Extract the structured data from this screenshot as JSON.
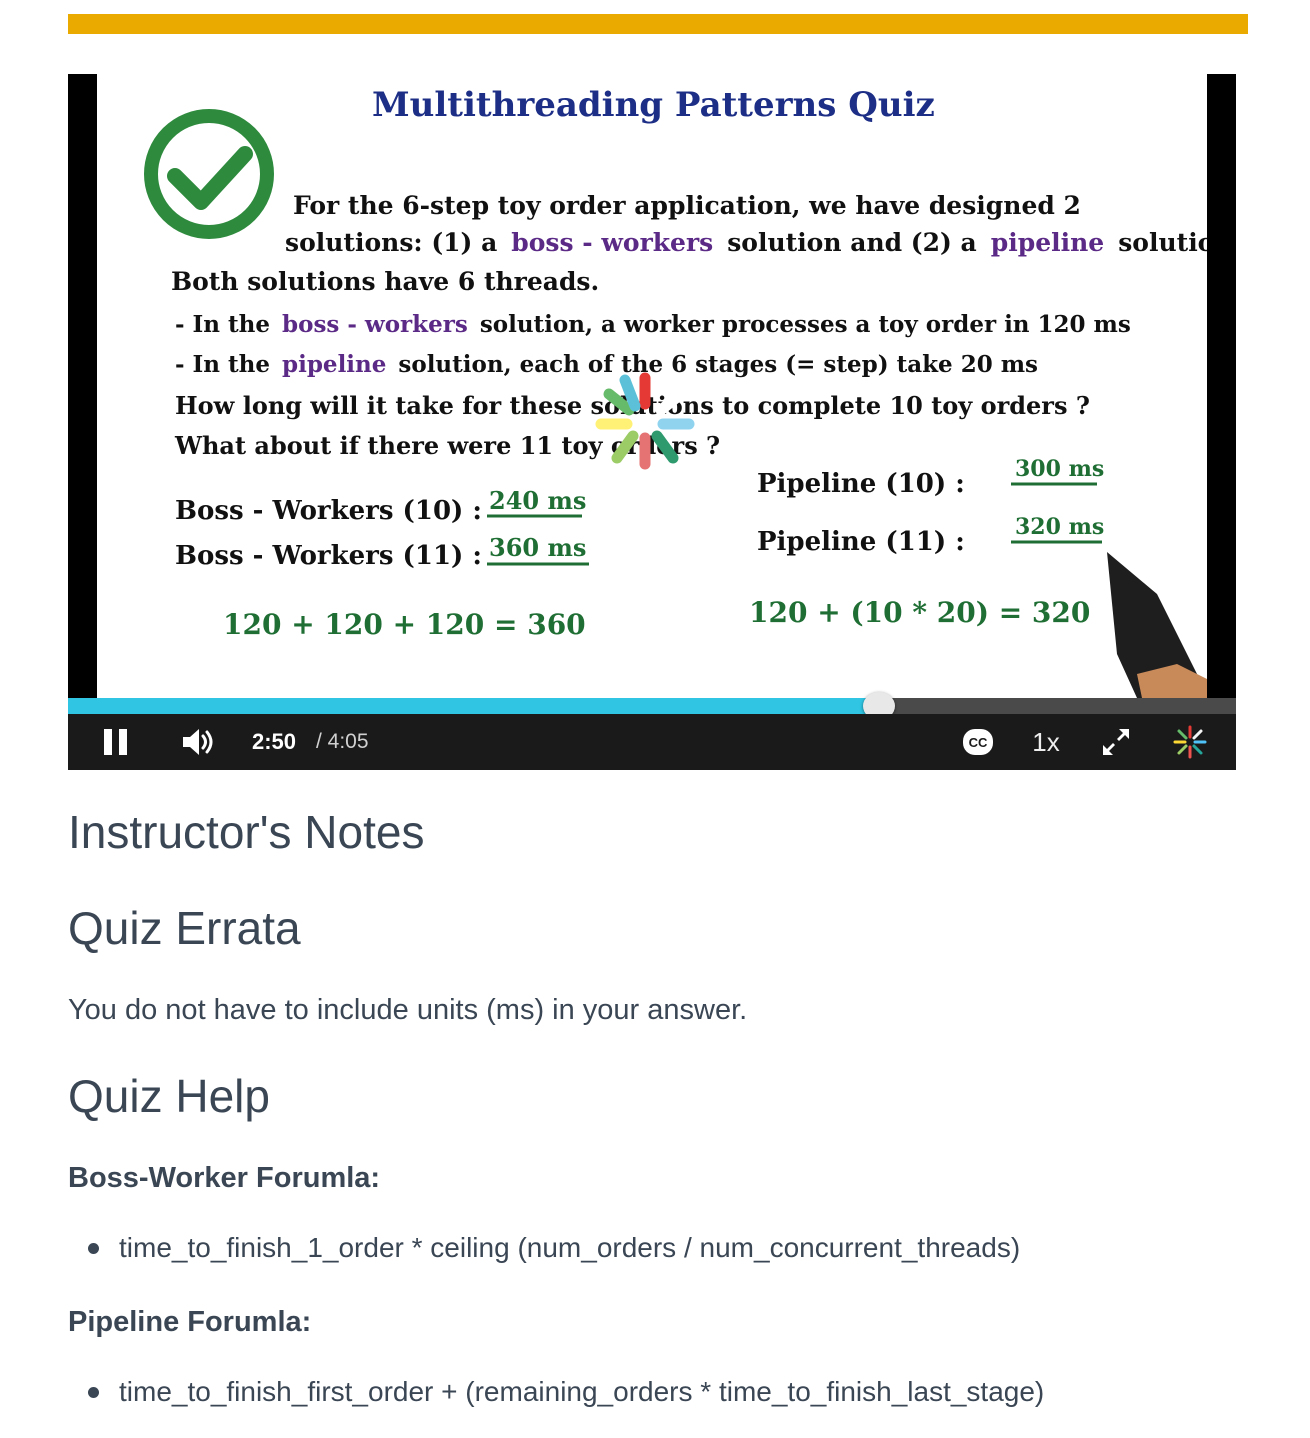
{
  "colors": {
    "accent_bar": "#ebaa00",
    "progress_fill": "#2fc5e3",
    "check_green": "#2e8b3e",
    "ink_blue": "#1c2e86",
    "ink_black": "#111111",
    "ink_purple": "#5b2a86",
    "ink_green": "#1f6e34"
  },
  "player": {
    "playback": {
      "current_time": "2:50",
      "duration": "/ 4:05",
      "progress": 0.694
    },
    "speed_label": "1x",
    "icons": {
      "pause": "pause-icon",
      "volume": "volume-icon",
      "captions": "cc-icon",
      "fullscreen": "fullscreen-icon",
      "logo": "udacity-spinner-icon"
    },
    "slide": {
      "title": "Multithreading Patterns Quiz",
      "l1a": "For the 6-step toy order application, we have designed 2",
      "l2a": "solutions: (1) a",
      "l2b": "boss - workers",
      "l2c": "solution and (2) a",
      "l2d": "pipeline",
      "l2e": "solution.",
      "l3": "Both solutions have 6 threads.",
      "l4a": "- In the",
      "l4b": "boss - workers",
      "l4c": "solution, a worker processes a toy order in 120 ms",
      "l5a": "- In the",
      "l5b": "pipeline",
      "l5c": "solution, each of the 6 stages (= step) take 20 ms",
      "l6": "How long will it take for these solutions to complete 10 toy orders ?",
      "l7": "What about if there were 11 toy orders ?",
      "bw10_label": "Boss - Workers (10) :",
      "bw10_answer": "240 ms",
      "bw11_label": "Boss - Workers (11) :",
      "bw11_answer": "360 ms",
      "pl10_label": "Pipeline (10) :",
      "pl10_answer": "300 ms",
      "pl11_label": "Pipeline (11) :",
      "pl11_answer": "320 ms",
      "calc_bw": "120 + 120 + 120 = 360",
      "calc_pl": "120 + (10 * 20) = 320"
    }
  },
  "notes": {
    "heading": "Instructor's Notes",
    "errata_heading": "Quiz Errata",
    "errata_text": "You do not have to include units (ms) in your answer.",
    "help_heading": "Quiz Help",
    "bw_heading": "Boss-Worker Forumla:",
    "bw_formula": "time_to_finish_1_order * ceiling (num_orders / num_concurrent_threads)",
    "pl_heading": "Pipeline Forumla:",
    "pl_formula": "time_to_finish_first_order + (remaining_orders * time_to_finish_last_stage)"
  }
}
